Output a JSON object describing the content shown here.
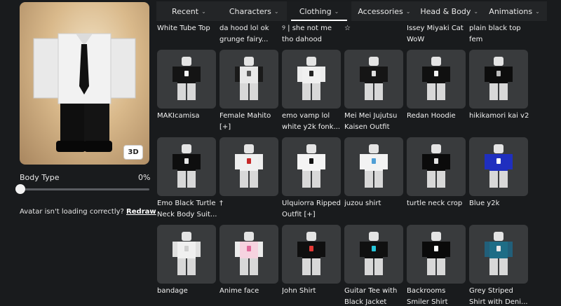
{
  "preview": {
    "view_3d_label": "3D"
  },
  "body_type": {
    "label": "Body Type",
    "value_text": "0%",
    "value": 0
  },
  "loading": {
    "text": "Avatar isn't loading correctly?",
    "redraw": "Redraw"
  },
  "tabs": [
    {
      "label": "Recent",
      "active": false
    },
    {
      "label": "Characters",
      "active": false
    },
    {
      "label": "Clothing",
      "active": true
    },
    {
      "label": "Accessories",
      "active": false
    },
    {
      "label": "Head & Body",
      "active": false
    },
    {
      "label": "Animations",
      "active": false
    }
  ],
  "top_row_names": [
    "White Tube Top",
    "da hood lol ok grunge fairy...",
    "୨ | she not me tho dahood",
    "☆",
    "Issey Miyaki Cat WoW",
    "plain black top fem"
  ],
  "items": [
    {
      "name": "MAKIcamisa",
      "torso": "#141414",
      "arms": "#141414",
      "accent": "#f5f5f5"
    },
    {
      "name": "Female Mahito [+]",
      "torso": "#e8e8e8",
      "arms": "#1a1a1a",
      "accent": "#555555"
    },
    {
      "name": "emo vamp lol white y2k fonk...",
      "torso": "#f0f0f0",
      "arms": "#ececec",
      "accent": "#222222"
    },
    {
      "name": "Mei Mei Jujutsu Kaisen Outfit",
      "torso": "#151515",
      "arms": "#151515",
      "accent": "#e0e0e0"
    },
    {
      "name": "Redan Hoodie",
      "torso": "#101010",
      "arms": "#101010",
      "accent": "#f2f2f2"
    },
    {
      "name": "hikikamori kai v2",
      "torso": "#0d0d0d",
      "arms": "#0d0d0d",
      "accent": "#bcbcbc"
    },
    {
      "name": "Emo Black Turtle Neck Body Suit...",
      "torso": "#0e0e0e",
      "arms": "#0e0e0e",
      "accent": "#e6e6e6"
    },
    {
      "name": "†",
      "torso": "#f0f0f0",
      "arms": "#eeeeee",
      "accent": "#c62828"
    },
    {
      "name": "Ulquiorra Ripped Outfit [+]",
      "torso": "#f4f4f4",
      "arms": "#f4f4f4",
      "accent": "#111111"
    },
    {
      "name": "juzou shirt",
      "torso": "#f3f3f3",
      "arms": "#f3f3f3",
      "accent": "#4f9fd6"
    },
    {
      "name": "turtle neck crop",
      "torso": "#0b0b0b",
      "arms": "#0b0b0b",
      "accent": "#e2e2e2"
    },
    {
      "name": "Blue y2k",
      "torso": "#1f2fbf",
      "arms": "#1f2fbf",
      "accent": "#ffffff"
    },
    {
      "name": "bandage",
      "torso": "#f0f0f0",
      "arms": "#e0e0e0",
      "accent": "#cfcfcf"
    },
    {
      "name": "Anime face",
      "torso": "#f6d3e0",
      "arms": "#ececec",
      "accent": "#e06a9a"
    },
    {
      "name": "John Shirt",
      "torso": "#0f0f0f",
      "arms": "#0f0f0f",
      "accent": "#e53935"
    },
    {
      "name": "Guitar Tee with Black Jacket",
      "torso": "#101010",
      "arms": "#101010",
      "accent": "#26c6da"
    },
    {
      "name": "Backrooms Smiler Shirt",
      "torso": "#0a0a0a",
      "arms": "#0a0a0a",
      "accent": "#ffffff"
    },
    {
      "name": "Grey Striped Shirt with Deni...",
      "torso": "#1e6d86",
      "arms": "#215f7a",
      "accent": "#e8e8e8"
    }
  ]
}
